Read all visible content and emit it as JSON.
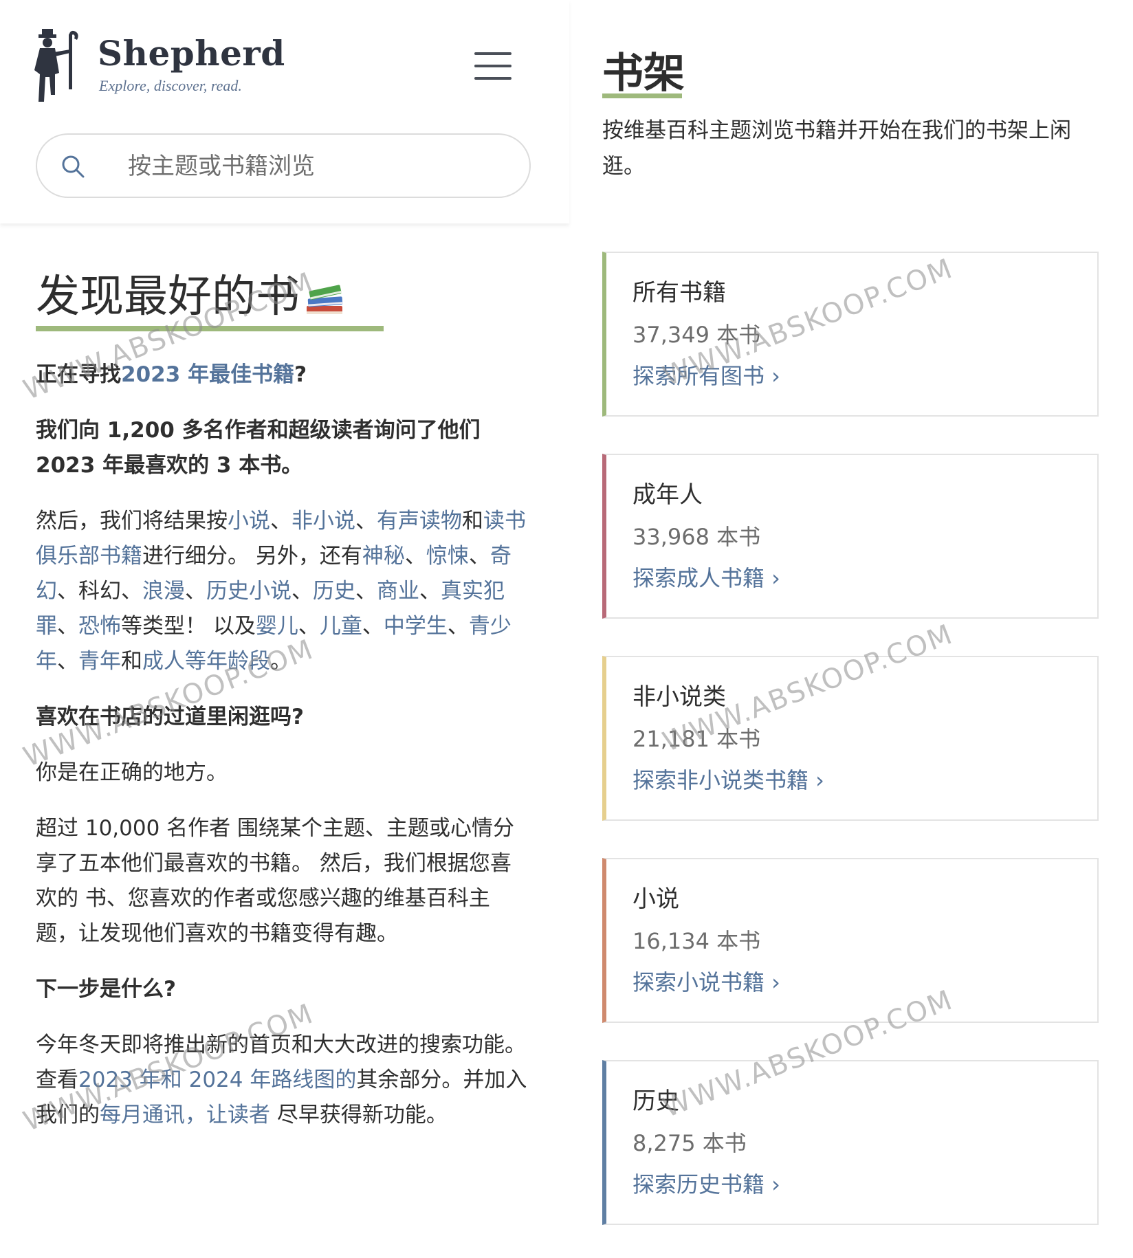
{
  "app": {
    "brand_name": "Shepherd",
    "brand_tagline": "Explore, discover, read."
  },
  "search": {
    "placeholder": "按主题或书籍浏览"
  },
  "main": {
    "hero_title": "发现最好的书",
    "p1": {
      "prefix": "正在寻找",
      "link": "2023 年最佳书籍",
      "suffix": "?"
    },
    "p2": "我们向 1,200 多名作者和超级读者询问了他们 2023 年最喜欢的 3 本书。",
    "p3": {
      "t1": "然后，我们将结果按",
      "l_novel": "小说",
      "sep1": "、",
      "l_nonfiction": "非小说",
      "sep2": "、",
      "l_audio": "有声读物",
      "t2": "和",
      "l_bookclub": "读书俱乐部书籍",
      "t3": "进行细分。 另外，还有",
      "l_mystery": "神秘",
      "sep3": "、",
      "l_thriller": "惊悚",
      "sep4": "、",
      "l_fantasy": "奇幻",
      "t4": "、科幻、",
      "l_romance": "浪漫",
      "sep5": "、",
      "l_histfic": "历史小说",
      "sep6": "、",
      "l_history": "历史",
      "sep7": "、",
      "l_business": "商业",
      "sep8": "、",
      "l_truecrime": "真实犯罪",
      "sep9": "、",
      "l_horror": "恐怖",
      "t5": "等类型！ 以及",
      "l_baby": "婴儿",
      "sep10": "、",
      "l_children": "儿童",
      "sep11": "、",
      "l_middle": "中学生",
      "sep12": "、",
      "l_teen": "青少年",
      "sep13": "、",
      "l_ya": "青年",
      "t6": "和",
      "l_adult": "成人等年龄段",
      "t7": "。"
    },
    "h_browse": "喜欢在书店的过道里闲逛吗?",
    "p4": "你是在正确的地方。",
    "p5": "超过 10,000 名作者 围绕某个主题、主题或心情分享了五本他们最喜欢的书籍。 然后，我们根据您喜欢的 书、您喜欢的作者或您感兴趣的维基百科主题，让发现他们喜欢的书籍变得有趣。",
    "h_next": "下一步是什么?",
    "p6": {
      "t1": "今年冬天即将推出新的首页和大大改进的搜索功能。查看",
      "l_roadmap": "2023 年和 2024 年路线图的",
      "t2": "其余部分。并加入我们的",
      "l_newsletter": "每月通讯，让读者",
      "t3": " 尽早获得新功能。"
    }
  },
  "shelf": {
    "title": "书架",
    "description": "按维基百科主题浏览书籍并开始在我们的书架上闲逛。",
    "cards": [
      {
        "title": "所有书籍",
        "count": "37,349 本书",
        "link": "探索所有图书 ›",
        "accent": "#9eb97c"
      },
      {
        "title": "成年人",
        "count": "33,968 本书",
        "link": "探索成人书籍 ›",
        "accent": "#b86a78"
      },
      {
        "title": "非小说类",
        "count": "21,181 本书",
        "link": "探索非小说类书籍 ›",
        "accent": "#e6cf8e"
      },
      {
        "title": "小说",
        "count": "16,134 本书",
        "link": "探索小说书籍 ›",
        "accent": "#cf8a6e"
      },
      {
        "title": "历史",
        "count": "8,275 本书",
        "link": "探索历史书籍 ›",
        "accent": "#5f7fa3"
      }
    ]
  },
  "watermark": "WWW.ABSKOOP.COM",
  "colors": {
    "accent_green": "#9eb97c",
    "link_blue": "#54739a"
  }
}
